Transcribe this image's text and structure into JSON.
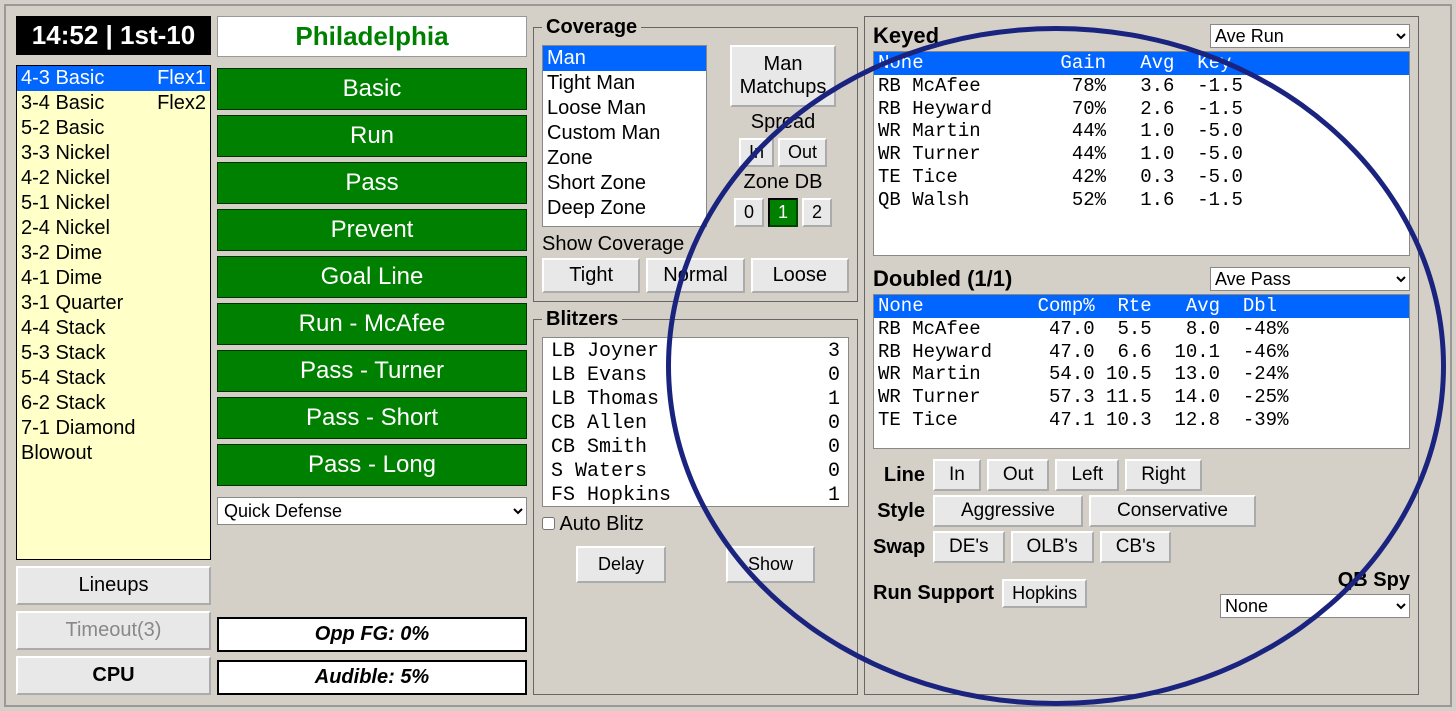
{
  "clock": {
    "time": "14:52",
    "down": "1st-10"
  },
  "formations": [
    {
      "name": "4-3 Basic",
      "sub": "Flex1",
      "sel": true
    },
    {
      "name": "3-4 Basic",
      "sub": "Flex2"
    },
    {
      "name": "5-2 Basic"
    },
    {
      "name": "3-3 Nickel"
    },
    {
      "name": "4-2 Nickel"
    },
    {
      "name": "5-1 Nickel"
    },
    {
      "name": "2-4 Nickel"
    },
    {
      "name": "3-2 Dime"
    },
    {
      "name": "4-1 Dime"
    },
    {
      "name": "3-1 Quarter"
    },
    {
      "name": "4-4 Stack"
    },
    {
      "name": "5-3 Stack"
    },
    {
      "name": "5-4 Stack"
    },
    {
      "name": "6-2 Stack"
    },
    {
      "name": "7-1 Diamond"
    },
    {
      "name": "Blowout"
    }
  ],
  "side_btns": {
    "lineups": "Lineups",
    "timeout": "Timeout(3)",
    "cpu": "CPU"
  },
  "team": "Philadelphia",
  "plays": [
    "Basic",
    "Run",
    "Pass",
    "Prevent",
    "Goal Line",
    "Run - McAfee",
    "Pass - Turner",
    "Pass - Short",
    "Pass - Long"
  ],
  "quick_select": "Quick Defense",
  "status": {
    "fg": "Opp FG: 0%",
    "audible": "Audible: 5%"
  },
  "coverage": {
    "title": "Coverage",
    "items": [
      "Man",
      "Tight Man",
      "Loose Man",
      "Custom Man",
      "Zone",
      "Short Zone",
      "Deep Zone"
    ],
    "matchups": "Man Matchups",
    "spread_lbl": "Spread",
    "in": "In",
    "out": "Out",
    "zonedb_lbl": "Zone DB",
    "zonedb": [
      "0",
      "1",
      "2"
    ],
    "zonedb_sel": 1,
    "show_lbl": "Show Coverage",
    "tight": "Tight",
    "normal": "Normal",
    "loose": "Loose"
  },
  "blitz": {
    "title": "Blitzers",
    "rows": [
      {
        "pos": "LB",
        "name": "Joyner",
        "n": "3"
      },
      {
        "pos": "LB",
        "name": "Evans",
        "n": "0"
      },
      {
        "pos": "LB",
        "name": "Thomas",
        "n": "1"
      },
      {
        "pos": "CB",
        "name": "Allen",
        "n": "0"
      },
      {
        "pos": "CB",
        "name": "Smith",
        "n": "0"
      },
      {
        "pos": " S",
        "name": "Waters",
        "n": "0"
      },
      {
        "pos": "FS",
        "name": "Hopkins",
        "n": "1"
      }
    ],
    "auto": "Auto Blitz",
    "delay": "Delay",
    "show": "Show"
  },
  "keyed": {
    "title": "Keyed",
    "select": "Ave Run",
    "hdr": {
      "c0": "None",
      "c1": "Gain",
      "c2": "Avg",
      "c3": "Key"
    },
    "rows": [
      {
        "c0": "RB McAfee",
        "c1": "78%",
        "c2": "3.6",
        "c3": "-1.5"
      },
      {
        "c0": "RB Heyward",
        "c1": "70%",
        "c2": "2.6",
        "c3": "-1.5"
      },
      {
        "c0": "WR Martin",
        "c1": "44%",
        "c2": "1.0",
        "c3": "-5.0"
      },
      {
        "c0": "WR Turner",
        "c1": "44%",
        "c2": "1.0",
        "c3": "-5.0"
      },
      {
        "c0": "TE Tice",
        "c1": "42%",
        "c2": "0.3",
        "c3": "-5.0"
      },
      {
        "c0": "QB Walsh",
        "c1": "52%",
        "c2": "1.6",
        "c3": "-1.5"
      }
    ]
  },
  "doubled": {
    "title": "Doubled (1/1)",
    "select": "Ave Pass",
    "hdr": {
      "c0": "None",
      "c1": "Comp%",
      "c2": "Rte",
      "c3": "Avg",
      "c4": "Dbl"
    },
    "rows": [
      {
        "c0": "RB McAfee",
        "c1": "47.0",
        "c2": "5.5",
        "c3": "8.0",
        "c4": "-48%"
      },
      {
        "c0": "RB Heyward",
        "c1": "47.0",
        "c2": "6.6",
        "c3": "10.1",
        "c4": "-46%"
      },
      {
        "c0": "WR Martin",
        "c1": "54.0",
        "c2": "10.5",
        "c3": "13.0",
        "c4": "-24%"
      },
      {
        "c0": "WR Turner",
        "c1": "57.3",
        "c2": "11.5",
        "c3": "14.0",
        "c4": "-25%"
      },
      {
        "c0": "TE Tice",
        "c1": "47.1",
        "c2": "10.3",
        "c3": "12.8",
        "c4": "-39%"
      }
    ]
  },
  "line": {
    "lbl": "Line",
    "in": "In",
    "out": "Out",
    "left": "Left",
    "right": "Right"
  },
  "style": {
    "lbl": "Style",
    "agg": "Aggressive",
    "cons": "Conservative"
  },
  "swap": {
    "lbl": "Swap",
    "de": "DE's",
    "olb": "OLB's",
    "cb": "CB's"
  },
  "support": {
    "lbl": "Run Support",
    "val": "Hopkins"
  },
  "qbspy": {
    "lbl": "QB Spy",
    "val": "None"
  }
}
